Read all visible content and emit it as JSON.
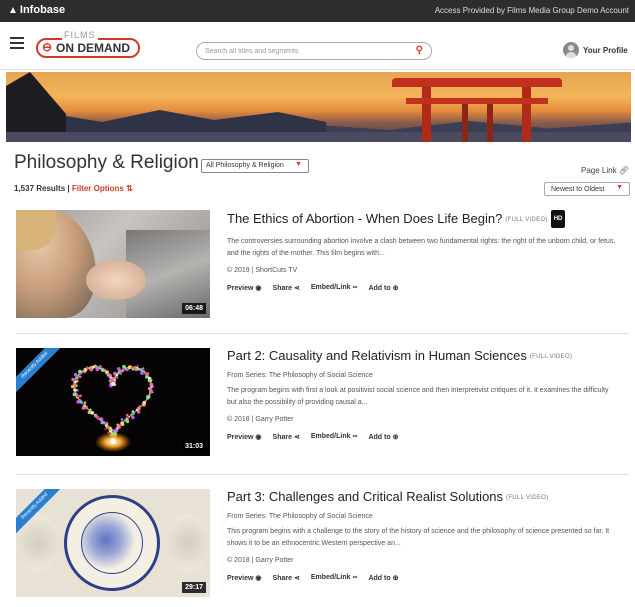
{
  "topbar": {
    "brand": "Infobase",
    "access_text": "Access Provided by Films Media Group Demo Account"
  },
  "header": {
    "logo_films": "FILMS",
    "logo_ondemand": "ON DEMAND",
    "search_placeholder": "Search all titles and segments",
    "profile_label": "Your Profile"
  },
  "page": {
    "title": "Philosophy & Religion",
    "category_select": "All Philosophy & Religion",
    "page_link": "Page Link",
    "results_count": "1,537 Results",
    "separator": " | ",
    "filter_label": "Filter Options",
    "sort_select": "Newest to Oldest"
  },
  "items": [
    {
      "title": "The Ethics of Abortion - When Does Life Begin?",
      "tag": "(FULL VIDEO)",
      "hd_badge": "HD",
      "series": "",
      "description": "The controversies surrounding abortion involve a clash between two fundamental rights: the right of the unborn child, or fetus, and the rights of the mother. This film begins with...",
      "meta": "© 2019 | ShortCuts TV",
      "duration": "06:48",
      "ribbon": "",
      "actions": [
        "Preview",
        "Share",
        "Embed/Link",
        "Add to"
      ]
    },
    {
      "title": "Part 2: Causality and Relativism in Human Sciences",
      "tag": "(FULL VIDEO)",
      "hd_badge": "",
      "series": "From Series: The Philosophy of Social Science",
      "description": "The program begins with first a look at positivist social science and then interpretivist critiques of it. It examines the difficulty but also the possibility of providing causal a...",
      "meta": "© 2018 | Garry Potter",
      "duration": "31:03",
      "ribbon": "Recently Added",
      "actions": [
        "Preview",
        "Share",
        "Embed/Link",
        "Add to"
      ]
    },
    {
      "title": "Part 3: Challenges and Critical Realist Solutions",
      "tag": "(FULL VIDEO)",
      "hd_badge": "",
      "series": "From Series: The Philosophy of Social Science",
      "description": "This program begins with a challenge to the story of the history of science and the philosophy of science presented so far. It shows it to be an ethnocentric Western perspective an...",
      "meta": "© 2018 | Garry Potter",
      "duration": "29:17",
      "ribbon": "Recently Added",
      "actions": [
        "Preview",
        "Share",
        "Embed/Link",
        "Add to"
      ]
    }
  ],
  "colors": {
    "accent": "#d23a2a",
    "topbar": "#2d2d2d",
    "ribbon": "#2b7fd0"
  }
}
